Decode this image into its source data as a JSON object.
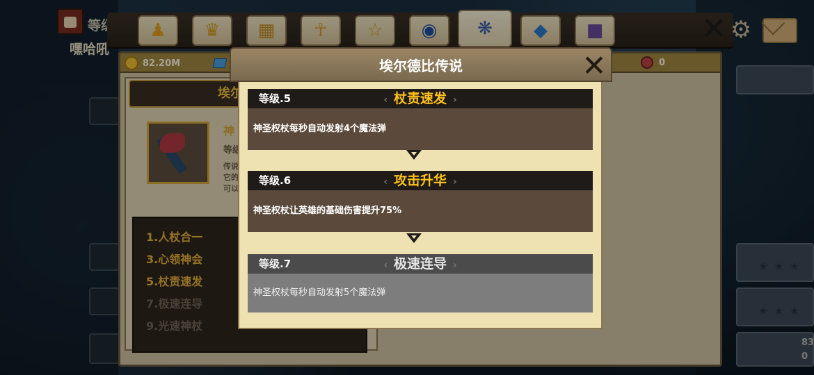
{
  "profile": {
    "level_label": "等级",
    "player_name": "嘿哈吼"
  },
  "tabs": [
    {
      "icon": "hero-icon"
    },
    {
      "icon": "demon-head-icon"
    },
    {
      "icon": "chest-icon"
    },
    {
      "icon": "ankh-icon"
    },
    {
      "icon": "trophy-icon"
    },
    {
      "icon": "orb-icon"
    },
    {
      "icon": "legend-emblem-icon",
      "active": true
    },
    {
      "icon": "gem-icon"
    },
    {
      "icon": "shirt-icon"
    }
  ],
  "currency": {
    "gold": "82.20M",
    "red_token": "0"
  },
  "item": {
    "name_partial": "埃尔",
    "line1_partial": "神",
    "line2_partial": "等级",
    "line3_partial": "传说",
    "line4_partial": "它的",
    "line5_partial": "可以",
    "skills_label_partial": "神"
  },
  "skill_list": [
    {
      "label": "1.人杖合一",
      "unlocked": true
    },
    {
      "label": "3.心领神会",
      "unlocked": true
    },
    {
      "label": "5.杖责速发",
      "unlocked": true
    },
    {
      "label": "7.极速连导",
      "unlocked": false
    },
    {
      "label": "9.光速神杖",
      "unlocked": false
    }
  ],
  "modal": {
    "title": "埃尔德比传说",
    "levels": [
      {
        "level": "等级.5",
        "skill": "杖责速发",
        "desc": "神圣权杖每秒自动发射4个魔法弹",
        "unlocked": true
      },
      {
        "level": "等级.6",
        "skill": "攻击升华",
        "desc": "神圣权杖让英雄的基础伤害提升75%",
        "unlocked": true
      },
      {
        "level": "等级.7",
        "skill": "极速连导",
        "desc": "神圣权杖每秒自动发射5个魔法弹",
        "unlocked": false
      }
    ]
  },
  "right_panel": {
    "num1": "83",
    "num2": "0"
  },
  "colors": {
    "gold_text": "#ffc21a",
    "skill_unlocked": "#e9b23a",
    "skill_locked": "#6f6658",
    "desc_bg": "#5b4a3c",
    "locked_bg": "#7d7d7d"
  }
}
